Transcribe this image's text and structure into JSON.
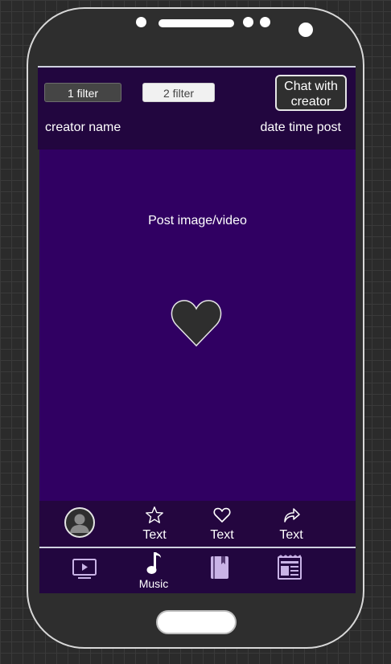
{
  "header": {
    "filter_1": "1 filter",
    "filter_2": "2 filter",
    "chat_button": "Chat with\ncreator",
    "creator_name": "creator name",
    "date_time": "date time post"
  },
  "post": {
    "media_label": "Post image/video",
    "like_icon": "heart-icon"
  },
  "actions": [
    {
      "icon": "star-icon",
      "label": "Text"
    },
    {
      "icon": "heart-outline-icon",
      "label": "Text"
    },
    {
      "icon": "share-icon",
      "label": "Text"
    }
  ],
  "nav": [
    {
      "icon": "video-icon",
      "label": ""
    },
    {
      "icon": "music-note-icon",
      "label": "Music"
    },
    {
      "icon": "book-icon",
      "label": ""
    },
    {
      "icon": "newspaper-icon",
      "label": ""
    }
  ],
  "colors": {
    "header_bg": "#22063f",
    "media_bg": "#300062",
    "accent_inactive": "#c9b3e6"
  }
}
